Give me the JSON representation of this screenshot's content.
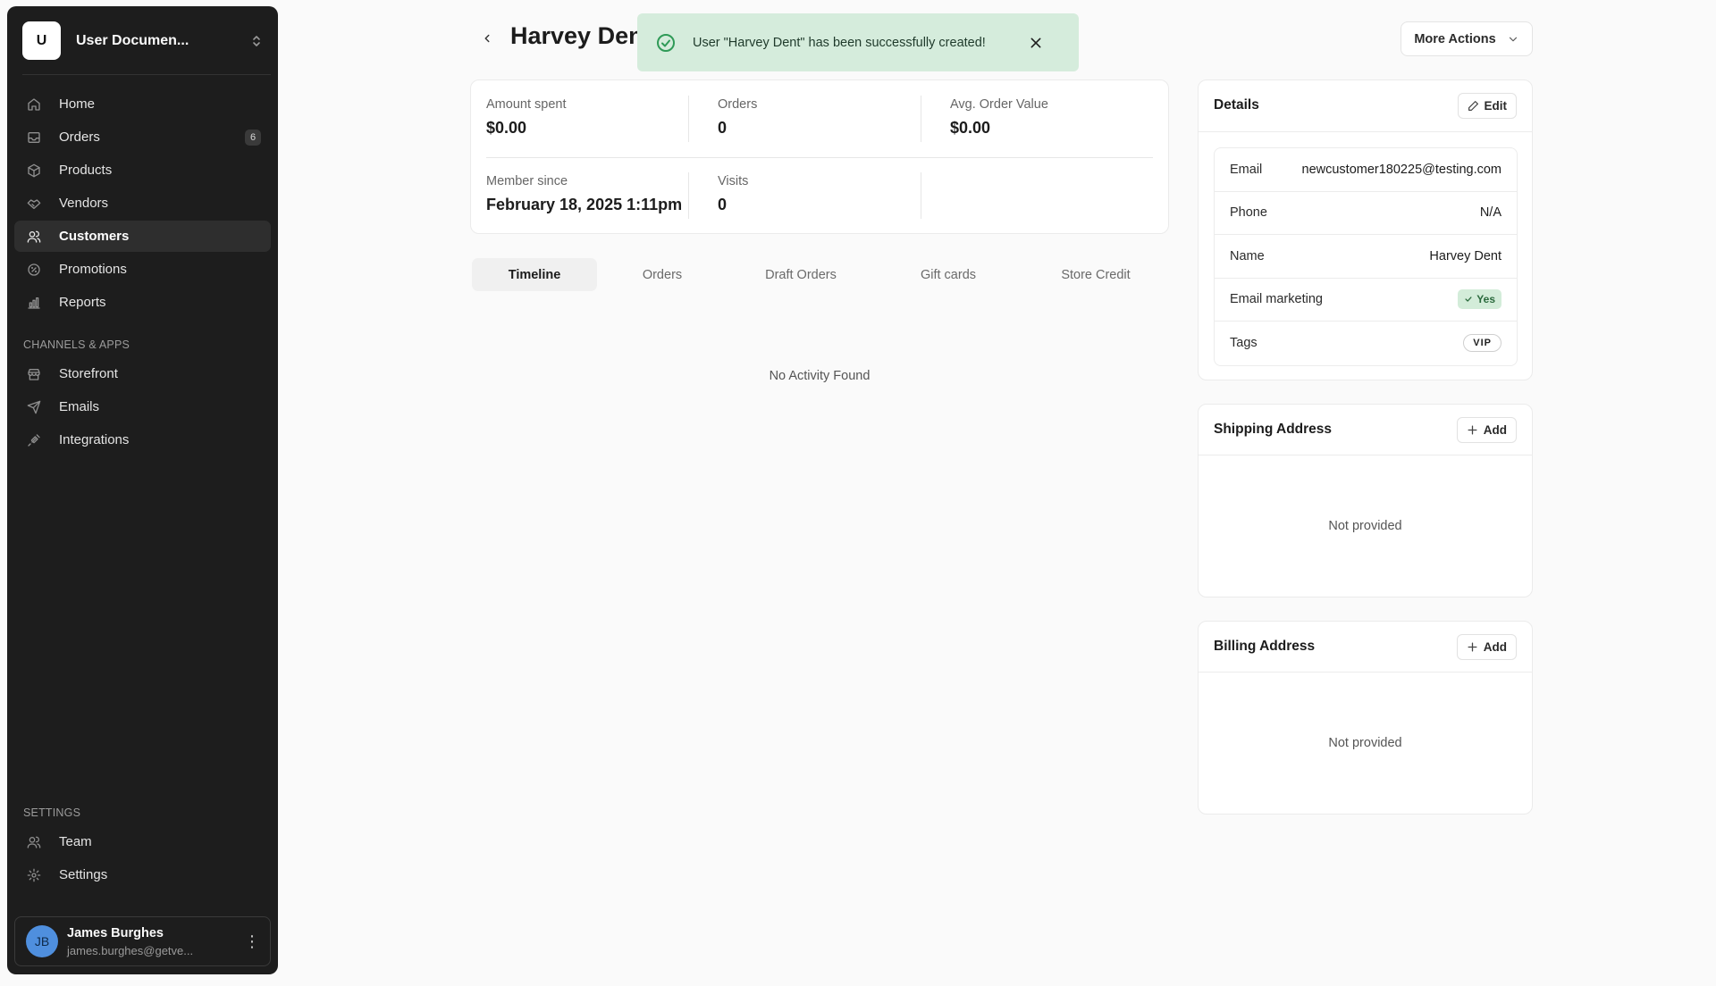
{
  "sidebar": {
    "store": {
      "initial": "U",
      "name": "User Documen..."
    },
    "nav": [
      {
        "label": "Home",
        "icon": "home-icon"
      },
      {
        "label": "Orders",
        "icon": "inbox-icon",
        "badge": "6"
      },
      {
        "label": "Products",
        "icon": "package-icon"
      },
      {
        "label": "Vendors",
        "icon": "handshake-icon"
      },
      {
        "label": "Customers",
        "icon": "users-icon",
        "active": true
      },
      {
        "label": "Promotions",
        "icon": "percent-icon"
      },
      {
        "label": "Reports",
        "icon": "bar-chart-icon"
      }
    ],
    "channels_title": "CHANNELS & APPS",
    "channels": [
      {
        "label": "Storefront",
        "icon": "store-icon"
      },
      {
        "label": "Emails",
        "icon": "send-icon"
      },
      {
        "label": "Integrations",
        "icon": "plug-icon"
      }
    ],
    "settings_title": "SETTINGS",
    "settings": [
      {
        "label": "Team",
        "icon": "users-icon"
      },
      {
        "label": "Settings",
        "icon": "gear-icon"
      }
    ],
    "user": {
      "initials": "JB",
      "name": "James Burghes",
      "email": "james.burghes@getve..."
    }
  },
  "header": {
    "title": "Harvey Dent",
    "more_actions": "More Actions"
  },
  "toast": {
    "message": "User \"Harvey Dent\" has been successfully created!"
  },
  "stats": {
    "amount_spent_label": "Amount spent",
    "amount_spent": "$0.00",
    "orders_label": "Orders",
    "orders": "0",
    "aov_label": "Avg. Order Value",
    "aov": "$0.00",
    "member_since_label": "Member since",
    "member_since": "February 18, 2025 1:11pm",
    "visits_label": "Visits",
    "visits": "0"
  },
  "tabs": [
    {
      "label": "Timeline",
      "active": true
    },
    {
      "label": "Orders"
    },
    {
      "label": "Draft Orders"
    },
    {
      "label": "Gift cards"
    },
    {
      "label": "Store Credit"
    }
  ],
  "timeline_empty": "No Activity Found",
  "details": {
    "title": "Details",
    "edit_label": "Edit",
    "rows": {
      "email": {
        "key": "Email",
        "value": "newcustomer180225@testing.com"
      },
      "phone": {
        "key": "Phone",
        "value": "N/A"
      },
      "name": {
        "key": "Name",
        "value": "Harvey Dent"
      },
      "marketing": {
        "key": "Email marketing",
        "value": "Yes"
      },
      "tags": {
        "key": "Tags",
        "value": "VIP"
      }
    }
  },
  "shipping": {
    "title": "Shipping Address",
    "add_label": "Add",
    "empty": "Not provided"
  },
  "billing": {
    "title": "Billing Address",
    "add_label": "Add",
    "empty": "Not provided"
  },
  "colors": {
    "sidebar_bg": "#1d1d1d",
    "toast_bg": "#d5ecdc",
    "success": "#2f9a57",
    "avatar": "#4f8fde"
  }
}
